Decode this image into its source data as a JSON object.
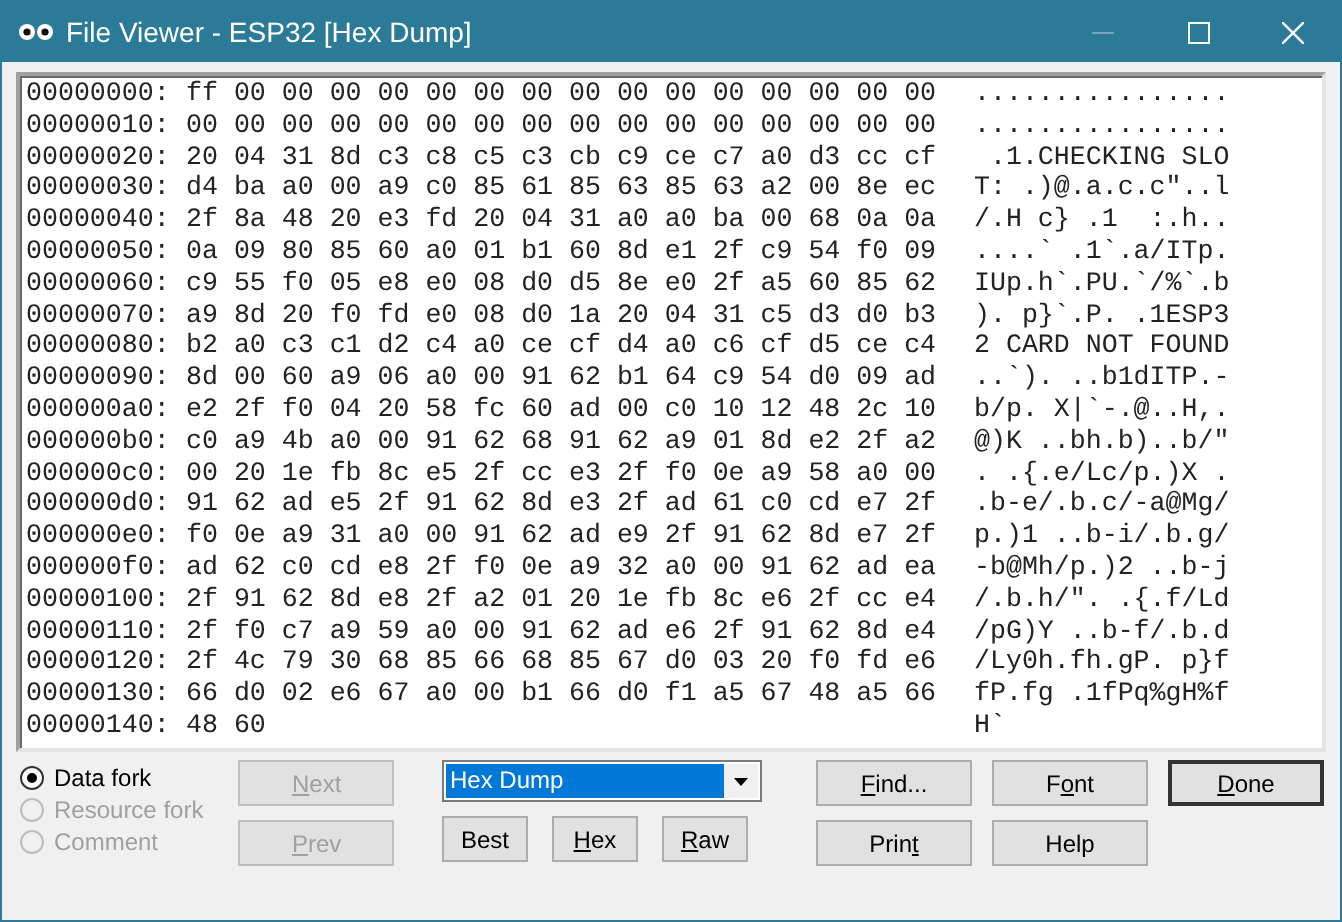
{
  "window": {
    "title": "File Viewer - ESP32 [Hex Dump]"
  },
  "dump": [
    {
      "offset": "00000000:",
      "bytes": "ff 00 00 00 00 00 00 00 00 00 00 00 00 00 00 00",
      "ascii": "................"
    },
    {
      "offset": "00000010:",
      "bytes": "00 00 00 00 00 00 00 00 00 00 00 00 00 00 00 00",
      "ascii": "................"
    },
    {
      "offset": "00000020:",
      "bytes": "20 04 31 8d c3 c8 c5 c3 cb c9 ce c7 a0 d3 cc cf",
      "ascii": " .1.CHECKING SLO"
    },
    {
      "offset": "00000030:",
      "bytes": "d4 ba a0 00 a9 c0 85 61 85 63 85 63 a2 00 8e ec",
      "ascii": "T: .)@.a.c.c\"..l"
    },
    {
      "offset": "00000040:",
      "bytes": "2f 8a 48 20 e3 fd 20 04 31 a0 a0 ba 00 68 0a 0a",
      "ascii": "/.H c} .1  :.h.."
    },
    {
      "offset": "00000050:",
      "bytes": "0a 09 80 85 60 a0 01 b1 60 8d e1 2f c9 54 f0 09",
      "ascii": "....` .1`.a/ITp."
    },
    {
      "offset": "00000060:",
      "bytes": "c9 55 f0 05 e8 e0 08 d0 d5 8e e0 2f a5 60 85 62",
      "ascii": "IUp.h`.PU.`/%`.b"
    },
    {
      "offset": "00000070:",
      "bytes": "a9 8d 20 f0 fd e0 08 d0 1a 20 04 31 c5 d3 d0 b3",
      "ascii": "). p}`.P. .1ESP3"
    },
    {
      "offset": "00000080:",
      "bytes": "b2 a0 c3 c1 d2 c4 a0 ce cf d4 a0 c6 cf d5 ce c4",
      "ascii": "2 CARD NOT FOUND"
    },
    {
      "offset": "00000090:",
      "bytes": "8d 00 60 a9 06 a0 00 91 62 b1 64 c9 54 d0 09 ad",
      "ascii": "..`). ..b1dITP.-"
    },
    {
      "offset": "000000a0:",
      "bytes": "e2 2f f0 04 20 58 fc 60 ad 00 c0 10 12 48 2c 10",
      "ascii": "b/p. X|`-.@..H,."
    },
    {
      "offset": "000000b0:",
      "bytes": "c0 a9 4b a0 00 91 62 68 91 62 a9 01 8d e2 2f a2",
      "ascii": "@)K ..bh.b)..b/\""
    },
    {
      "offset": "000000c0:",
      "bytes": "00 20 1e fb 8c e5 2f cc e3 2f f0 0e a9 58 a0 00",
      "ascii": ". .{.e/Lc/p.)X ."
    },
    {
      "offset": "000000d0:",
      "bytes": "91 62 ad e5 2f 91 62 8d e3 2f ad 61 c0 cd e7 2f",
      "ascii": ".b-e/.b.c/-a@Mg/"
    },
    {
      "offset": "000000e0:",
      "bytes": "f0 0e a9 31 a0 00 91 62 ad e9 2f 91 62 8d e7 2f",
      "ascii": "p.)1 ..b-i/.b.g/"
    },
    {
      "offset": "000000f0:",
      "bytes": "ad 62 c0 cd e8 2f f0 0e a9 32 a0 00 91 62 ad ea",
      "ascii": "-b@Mh/p.)2 ..b-j"
    },
    {
      "offset": "00000100:",
      "bytes": "2f 91 62 8d e8 2f a2 01 20 1e fb 8c e6 2f cc e4",
      "ascii": "/.b.h/\". .{.f/Ld"
    },
    {
      "offset": "00000110:",
      "bytes": "2f f0 c7 a9 59 a0 00 91 62 ad e6 2f 91 62 8d e4",
      "ascii": "/pG)Y ..b-f/.b.d"
    },
    {
      "offset": "00000120:",
      "bytes": "2f 4c 79 30 68 85 66 68 85 67 d0 03 20 f0 fd e6",
      "ascii": "/Ly0h.fh.gP. p}f"
    },
    {
      "offset": "00000130:",
      "bytes": "66 d0 02 e6 67 a0 00 b1 66 d0 f1 a5 67 48 a5 66",
      "ascii": "fP.fg .1fPq%gH%f"
    },
    {
      "offset": "00000140:",
      "bytes": "48 60",
      "ascii": "H`"
    }
  ],
  "forks": [
    {
      "label": "Data fork",
      "selected": true,
      "disabled": false
    },
    {
      "label": "Resource fork",
      "selected": false,
      "disabled": true
    },
    {
      "label": "Comment",
      "selected": false,
      "disabled": true
    }
  ],
  "nav_buttons": [
    {
      "key": "N",
      "post": "ext",
      "disabled": true
    },
    {
      "key": "P",
      "post": "rev",
      "disabled": true
    }
  ],
  "format_select": {
    "value": "Hex Dump"
  },
  "format_buttons": [
    {
      "post": "Best"
    },
    {
      "key": "H",
      "post": "ex"
    },
    {
      "key": "R",
      "post": "aw"
    }
  ],
  "action_buttons": [
    {
      "key": "F",
      "post": "ind..."
    },
    {
      "pre": "F",
      "key": "o",
      "post": "nt"
    },
    {
      "key": "D",
      "post": "one",
      "default": true
    },
    {
      "pre": "Prin",
      "key": "t"
    },
    {
      "post": "Help"
    }
  ]
}
